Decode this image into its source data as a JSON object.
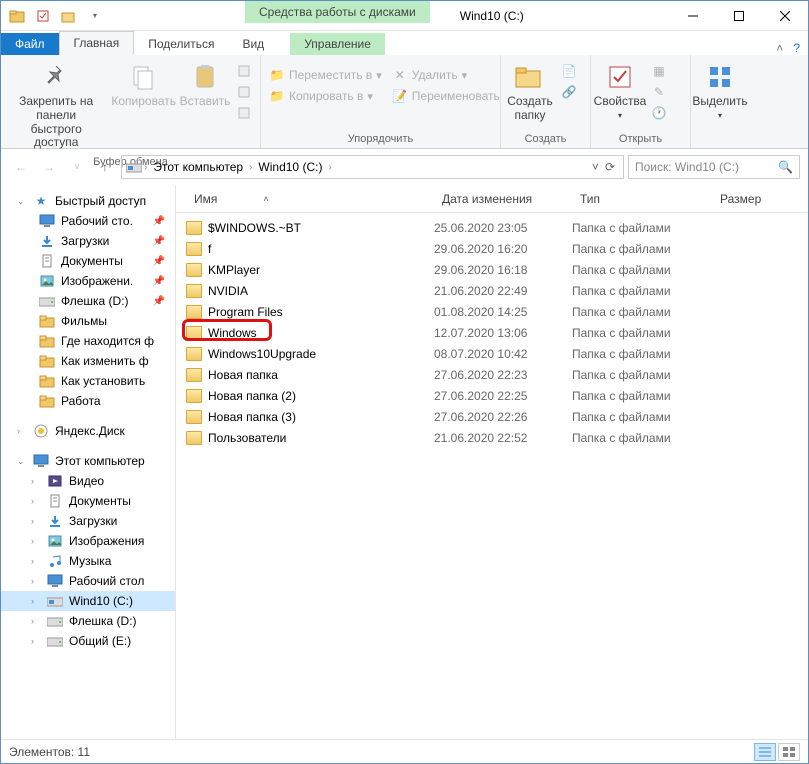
{
  "titlebar": {
    "context_tool": "Средства работы с дисками",
    "title": "Wind10 (C:)"
  },
  "ribbon_tabs": {
    "file": "Файл",
    "home": "Главная",
    "share": "Поделиться",
    "view": "Вид",
    "manage": "Управление"
  },
  "ribbon": {
    "clipboard": {
      "pin": "Закрепить на панели\nбыстрого доступа",
      "copy": "Копировать",
      "paste": "Вставить",
      "label": "Буфер обмена"
    },
    "organize": {
      "moveto": "Переместить в",
      "copyto": "Копировать в",
      "delete": "Удалить",
      "rename": "Переименовать",
      "label": "Упорядочить"
    },
    "new": {
      "newfolder": "Создать\nпапку",
      "label": "Создать"
    },
    "open": {
      "properties": "Свойства",
      "label": "Открыть"
    },
    "select": {
      "select": "Выделить",
      "label": ""
    }
  },
  "breadcrumb": {
    "pc": "Этот компьютер",
    "drive": "Wind10 (C:)"
  },
  "search": {
    "placeholder": "Поиск: Wind10 (C:)"
  },
  "columns": {
    "name": "Имя",
    "date": "Дата изменения",
    "type": "Тип",
    "size": "Размер"
  },
  "sidebar": {
    "quick": "Быстрый доступ",
    "items_quick": [
      {
        "label": "Рабочий сто.",
        "icon": "desktop",
        "pin": true
      },
      {
        "label": "Загрузки",
        "icon": "downloads",
        "pin": true
      },
      {
        "label": "Документы",
        "icon": "documents",
        "pin": true
      },
      {
        "label": "Изображени.",
        "icon": "pictures",
        "pin": true
      },
      {
        "label": "Флешка (D:)",
        "icon": "drive",
        "pin": true
      },
      {
        "label": "Фильмы",
        "icon": "folder",
        "pin": false
      },
      {
        "label": "Где находится ф",
        "icon": "folder",
        "pin": false
      },
      {
        "label": "Как изменить ф",
        "icon": "folder",
        "pin": false
      },
      {
        "label": "Как установить",
        "icon": "folder",
        "pin": false
      },
      {
        "label": "Работа",
        "icon": "folder",
        "pin": false
      }
    ],
    "yandex": "Яндекс.Диск",
    "pc": "Этот компьютер",
    "items_pc": [
      {
        "label": "Видео",
        "icon": "videos"
      },
      {
        "label": "Документы",
        "icon": "documents"
      },
      {
        "label": "Загрузки",
        "icon": "downloads"
      },
      {
        "label": "Изображения",
        "icon": "pictures"
      },
      {
        "label": "Музыка",
        "icon": "music"
      },
      {
        "label": "Рабочий стол",
        "icon": "desktop"
      },
      {
        "label": "Wind10 (C:)",
        "icon": "drive-c",
        "selected": true
      },
      {
        "label": "Флешка (D:)",
        "icon": "drive"
      },
      {
        "label": "Общий (E:)",
        "icon": "drive"
      }
    ]
  },
  "files": [
    {
      "name": "$WINDOWS.~BT",
      "date": "25.06.2020 23:05",
      "type": "Папка с файлами"
    },
    {
      "name": "f",
      "date": "29.06.2020 16:20",
      "type": "Папка с файлами"
    },
    {
      "name": "KMPlayer",
      "date": "29.06.2020 16:18",
      "type": "Папка с файлами"
    },
    {
      "name": "NVIDIA",
      "date": "21.06.2020 22:49",
      "type": "Папка с файлами"
    },
    {
      "name": "Program Files",
      "date": "01.08.2020 14:25",
      "type": "Папка с файлами"
    },
    {
      "name": "Windows",
      "date": "12.07.2020 13:06",
      "type": "Папка с файлами",
      "highlight": true
    },
    {
      "name": "Windows10Upgrade",
      "date": "08.07.2020 10:42",
      "type": "Папка с файлами"
    },
    {
      "name": "Новая папка",
      "date": "27.06.2020 22:23",
      "type": "Папка с файлами"
    },
    {
      "name": "Новая папка (2)",
      "date": "27.06.2020 22:25",
      "type": "Папка с файлами"
    },
    {
      "name": "Новая папка (3)",
      "date": "27.06.2020 22:26",
      "type": "Папка с файлами"
    },
    {
      "name": "Пользователи",
      "date": "21.06.2020 22:52",
      "type": "Папка с файлами"
    }
  ],
  "status": {
    "count_label": "Элементов:",
    "count": "11"
  }
}
